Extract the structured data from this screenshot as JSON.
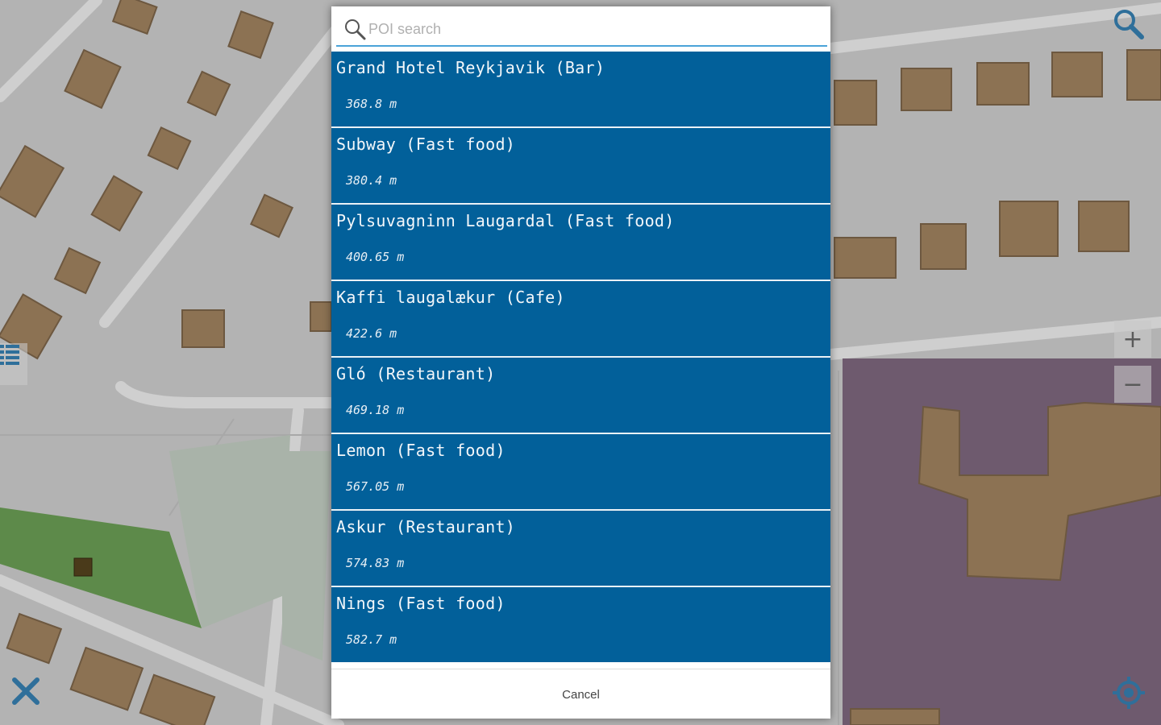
{
  "search": {
    "placeholder": "POI search",
    "value": ""
  },
  "results": [
    {
      "title": "Grand Hotel Reykjavik (Bar)",
      "distance": "368.8 m"
    },
    {
      "title": "Subway (Fast food)",
      "distance": "380.4 m"
    },
    {
      "title": "Pylsuvagninn Laugardal (Fast food)",
      "distance": "400.65 m"
    },
    {
      "title": "Kaffi laugalækur (Cafe)",
      "distance": "422.6 m"
    },
    {
      "title": "Gló (Restaurant)",
      "distance": "469.18 m"
    },
    {
      "title": "Lemon (Fast food)",
      "distance": "567.05 m"
    },
    {
      "title": "Askur (Restaurant)",
      "distance": "574.83 m"
    },
    {
      "title": "Nings (Fast food)",
      "distance": "582.7 m"
    }
  ],
  "cancel_label": "Cancel",
  "colors": {
    "row_bg": "#02609a",
    "accent": "#4aa3d8",
    "map_land": "#b7b7b7",
    "building": "#8c7253",
    "park": "#5d8a4a",
    "school_area": "#6e5a6e"
  },
  "map_controls": {
    "search_icon": "magnifier-icon",
    "zoom_in": "+",
    "zoom_out": "−",
    "close_icon": "close-x-icon",
    "locate_icon": "crosshair-icon",
    "layers_icon": "list-icon"
  }
}
